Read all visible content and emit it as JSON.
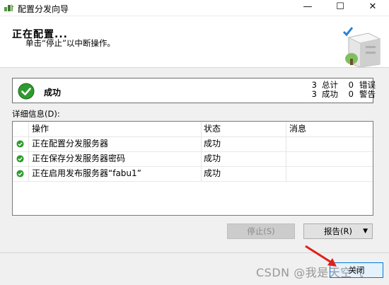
{
  "window": {
    "title": "配置分发向导",
    "minimize_glyph": "—",
    "maximize_glyph": "☐",
    "close_glyph": "✕"
  },
  "header": {
    "title": "正在配置...",
    "subtitle": "单击“停止”以中断操作。",
    "image_icon": "server-wizard-icon"
  },
  "status": {
    "icon": "success-check-icon",
    "text": "成功",
    "total_count": "3",
    "total_label": "总计",
    "error_count": "0",
    "error_label": "错误",
    "success_count": "3",
    "success_label": "成功",
    "warning_count": "0",
    "warning_label": "警告"
  },
  "details": {
    "label": "详细信息(D):",
    "columns": [
      "",
      "操作",
      "状态",
      "消息"
    ],
    "rows": [
      {
        "icon": "success-check-icon",
        "action": "正在配置分发服务器",
        "status": "成功",
        "message": ""
      },
      {
        "icon": "success-check-icon",
        "action": "正在保存分发服务器密码",
        "status": "成功",
        "message": ""
      },
      {
        "icon": "success-check-icon",
        "action": "正在启用发布服务器“fabu1”",
        "status": "成功",
        "message": ""
      }
    ]
  },
  "buttons": {
    "stop": "停止(S)",
    "report": "报告(R)",
    "report_arrow": "▼",
    "close": "关闭"
  },
  "watermark": "CSDN @我是天空气",
  "colors": {
    "success_green": "#2e9b2e",
    "accent_blue": "#0078d7",
    "annotation_red": "#e0201a"
  }
}
